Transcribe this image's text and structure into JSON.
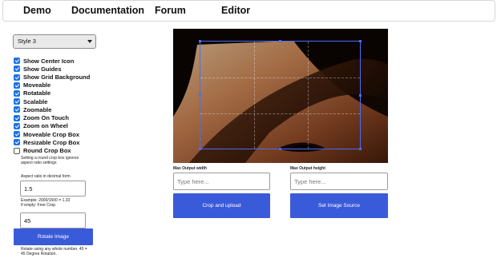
{
  "nav": {
    "items": [
      "Demo",
      "Documentation",
      "Forum",
      "Editor"
    ]
  },
  "controls": {
    "style_select": "Style 3",
    "options": [
      {
        "label": "Show Center Icon",
        "checked": true
      },
      {
        "label": "Show Guides",
        "checked": true
      },
      {
        "label": "Show Grid Background",
        "checked": true
      },
      {
        "label": "Moveable",
        "checked": true
      },
      {
        "label": "Rotatable",
        "checked": true
      },
      {
        "label": "Scalable",
        "checked": true
      },
      {
        "label": "Zoomable",
        "checked": true
      },
      {
        "label": "Zoom On Touch",
        "checked": true
      },
      {
        "label": "Zoom on Wheel",
        "checked": true
      },
      {
        "label": "Moveable Crop Box",
        "checked": true
      },
      {
        "label": "Resizable Crop Box",
        "checked": true
      },
      {
        "label": "Round Crop Box",
        "checked": false
      }
    ],
    "round_note": "Setting a round crop box ignores aspect ratio settings",
    "aspect_label": "Aspect ratio in decimal form",
    "aspect_value": "1.5",
    "aspect_example": "Example: 2000/1500 = 1.33",
    "aspect_empty": "If empty: Free Crop",
    "rotate_value": "45",
    "rotate_button": "Rotate Image",
    "rotate_note": "Rotate using any whole number. 45 = 45 Degree Rotation."
  },
  "output": {
    "width_label": "Max Output width",
    "width_placeholder": "Type here...",
    "height_label": "Max Output height",
    "height_placeholder": "Type here...",
    "crop_button": "Crop and upload",
    "source_button": "Set Image Source"
  },
  "colors": {
    "accent": "#3a5bd9",
    "checkbox": "#1a73e8",
    "crop_border": "#4a6cf7"
  }
}
